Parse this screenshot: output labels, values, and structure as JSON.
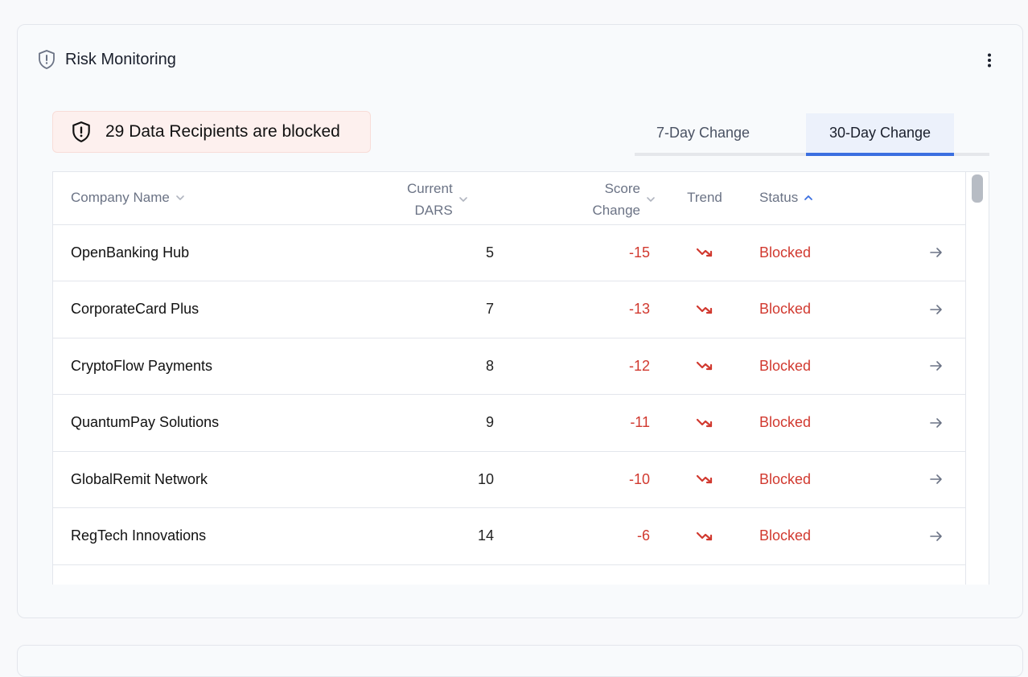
{
  "header": {
    "title": "Risk Monitoring",
    "icon": "shield-alert-icon",
    "menu_icon": "more-vertical-icon"
  },
  "alert": {
    "text": "29 Data Recipients are blocked",
    "icon": "shield-alert-icon"
  },
  "tabs": [
    {
      "label": "7-Day Change",
      "active": false
    },
    {
      "label": "30-Day Change",
      "active": true
    }
  ],
  "table": {
    "columns": {
      "company": "Company Name",
      "dars_line1": "Current",
      "dars_line2": "DARS",
      "score_line1": "Score",
      "score_line2": "Change",
      "trend": "Trend",
      "status": "Status"
    },
    "sort": {
      "column": "status",
      "direction": "asc"
    },
    "rows": [
      {
        "company": "OpenBanking Hub",
        "dars": "5",
        "score_change": "-15",
        "trend": "down",
        "status": "Blocked"
      },
      {
        "company": "CorporateCard Plus",
        "dars": "7",
        "score_change": "-13",
        "trend": "down",
        "status": "Blocked"
      },
      {
        "company": "CryptoFlow Payments",
        "dars": "8",
        "score_change": "-12",
        "trend": "down",
        "status": "Blocked"
      },
      {
        "company": "QuantumPay Solutions",
        "dars": "9",
        "score_change": "-11",
        "trend": "down",
        "status": "Blocked"
      },
      {
        "company": "GlobalRemit Network",
        "dars": "10",
        "score_change": "-10",
        "trend": "down",
        "status": "Blocked"
      },
      {
        "company": "RegTech Innovations",
        "dars": "14",
        "score_change": "-6",
        "trend": "down",
        "status": "Blocked"
      }
    ]
  },
  "colors": {
    "negative": "#d1392f",
    "accent": "#3b6fe0",
    "alert_bg": "#fdf0ee"
  }
}
